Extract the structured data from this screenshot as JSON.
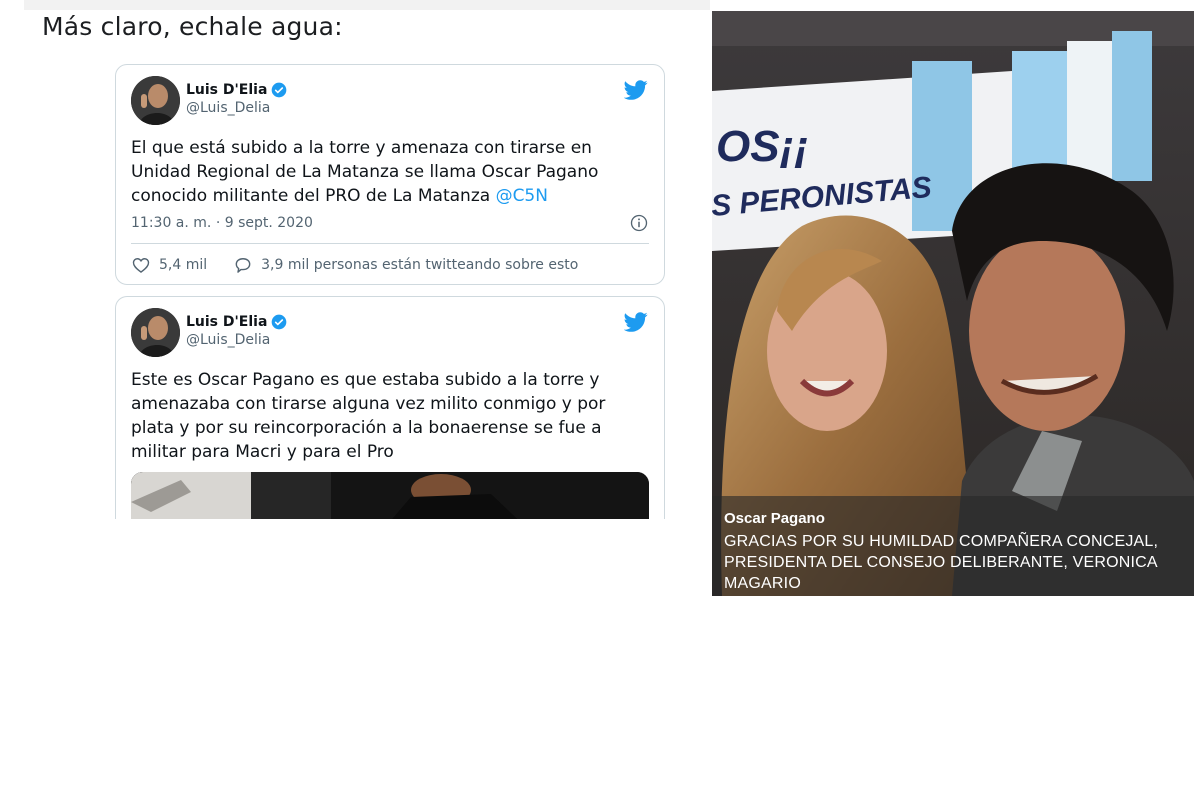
{
  "heading": "Más claro, echale agua:",
  "tweets": [
    {
      "author_name": "Luis D'Elia",
      "handle": "@Luis_Delia",
      "text": "El que está subido a la torre y amenaza con tirarse en Unidad Regional de La Matanza se llama Oscar Pagano conocido militante del PRO de La Matanza ",
      "mention": "@C5N",
      "timestamp": "11:30 a. m. · 9 sept. 2020",
      "likes": "5,4 mil",
      "conversation": "3,9 mil personas están twitteando sobre esto"
    },
    {
      "author_name": "Luis D'Elia",
      "handle": "@Luis_Delia",
      "text": "Este es Oscar Pagano es que estaba subido a la torre y amenazaba con tirarse alguna vez milito conmigo y por plata y por su reincorporación a la bonaerense se fue a militar para Macri y para el Pro"
    }
  ],
  "photo": {
    "banner_text_1": "OS¡¡",
    "banner_text_2": "S PERONISTAS",
    "caption_name": "Oscar Pagano",
    "caption_text": "GRACIAS POR SU HUMILDAD COMPAÑERA CONCEJAL, PRESIDENTA DEL CONSEJO DELIBERANTE, VERONICA MAGARIO"
  },
  "colors": {
    "twitter_blue": "#1d9bf0",
    "text_secondary": "#536471",
    "border": "#cfd9de"
  }
}
